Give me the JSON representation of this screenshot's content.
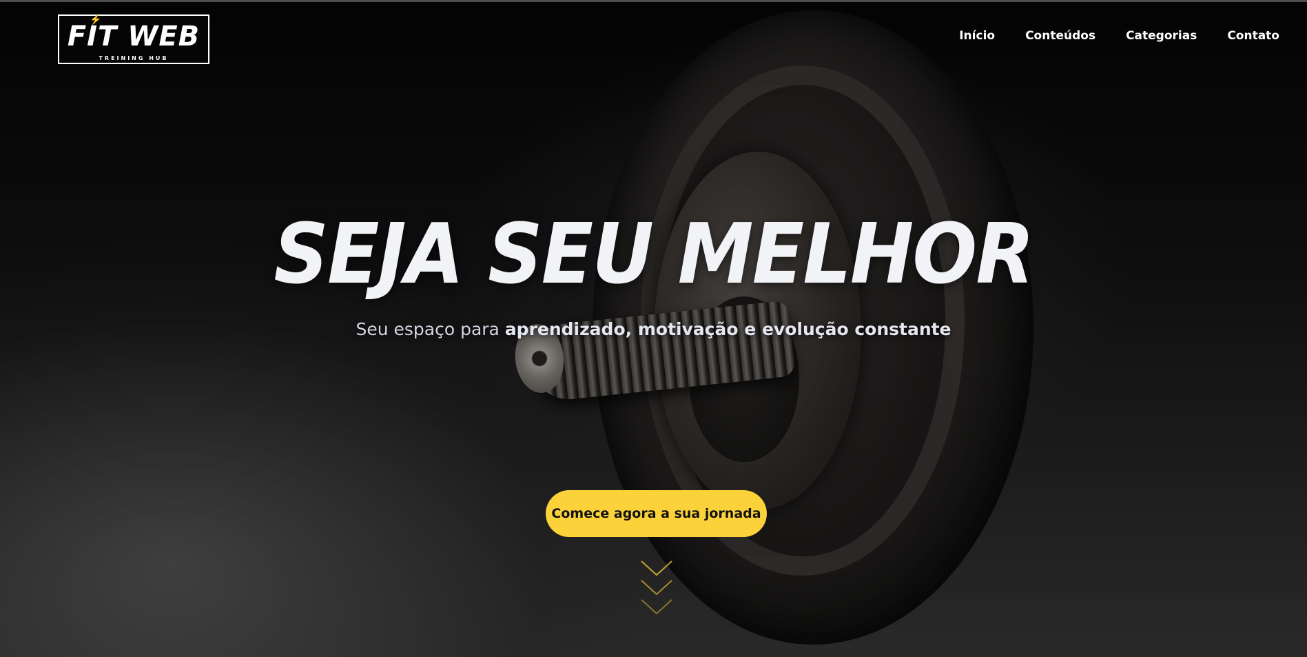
{
  "brand": {
    "name": "FIT WEB",
    "tagline": "TREINING HUB"
  },
  "nav": {
    "items": [
      "Início",
      "Conteúdos",
      "Categorias",
      "Contato"
    ]
  },
  "hero": {
    "title": "SEJA SEU MELHOR",
    "subtitle_plain": "Seu espaço para ",
    "subtitle_bold": "aprendizado, motivação e evolução constante",
    "cta_label": "Comece agora a sua jornada"
  },
  "icons": {
    "scroll_indicator": "chevron-down-icon",
    "logo_bolt": "lightning-icon"
  },
  "colors": {
    "accent": "#fcd23a",
    "title": "#f2f3f7",
    "subtitle": "#d4d6e2"
  }
}
